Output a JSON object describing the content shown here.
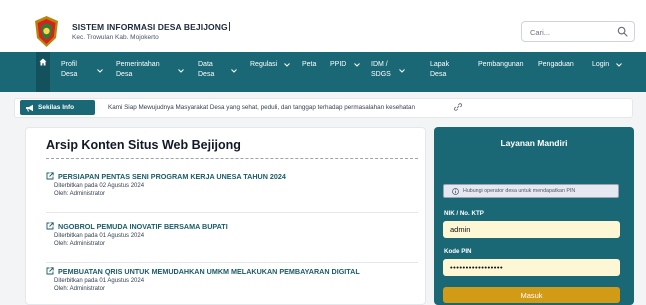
{
  "header": {
    "site_title": "SISTEM INFORMASI DESA BEJIJONG",
    "site_subtitle": "Kec. Trowulan Kab. Mojokerto",
    "search_placeholder": "Cari..."
  },
  "nav": {
    "items": [
      {
        "line1": "Profil",
        "line2": "Desa",
        "dropdown": true
      },
      {
        "line1": "Pemerintahan",
        "line2": "Desa",
        "dropdown": true
      },
      {
        "line1": "Data",
        "line2": "Desa",
        "dropdown": true
      },
      {
        "line1": "Regulasi",
        "line2": "",
        "dropdown": true
      },
      {
        "line1": "Peta",
        "line2": "",
        "dropdown": false
      },
      {
        "line1": "PPID",
        "line2": "",
        "dropdown": true
      },
      {
        "line1": "IDM /",
        "line2": "SDGS",
        "dropdown": true
      },
      {
        "line1": "Lapak",
        "line2": "Desa",
        "dropdown": false
      },
      {
        "line1": "Pembangunan",
        "line2": "",
        "dropdown": false
      },
      {
        "line1": "Pengaduan",
        "line2": "",
        "dropdown": false
      },
      {
        "line1": "Login",
        "line2": "",
        "dropdown": true
      }
    ]
  },
  "ticker": {
    "badge": "Sekilas Info",
    "text": "Kami Siap Mewujudnya Masyarakat Desa yang sehat, peduli, dan tanggap terhadap permasalahan kesehatan"
  },
  "archive": {
    "title": "Arsip Konten Situs Web Bejijong",
    "articles": [
      {
        "title": "PERSIAPAN PENTAS SENI PROGRAM KERJA UNESA TAHUN 2024",
        "date": "Diterbitkan pada 02 Agustus 2024",
        "author": "Oleh: Administrator"
      },
      {
        "title": "NGOBROL PEMUDA INOVATIF BERSAMA BUPATI",
        "date": "Diterbitkan pada 01 Agustus 2024",
        "author": "Oleh: Administrator"
      },
      {
        "title": "PEMBUATAN QRIS UNTUK MEMUDAHKAN UMKM MELAKUKAN PEMBAYARAN DIGITAL",
        "date": "Diterbitkan pada 01 Agustus 2024",
        "author": "Oleh: Administrator"
      }
    ]
  },
  "layanan": {
    "title": "Layanan Mandiri",
    "note": "Hubungi operator desa untuk mendapatkan PIN",
    "nik_label": "NIK / No. KTP",
    "nik_value": "admin",
    "pin_label": "Kode PIN",
    "pin_value": "•••••••••••••••••",
    "button": "Masuk"
  },
  "colors": {
    "nav": "#1a6876",
    "nav_active": "#13525d",
    "accent_button": "#d29b16",
    "input_fill": "#fdf7d5",
    "article_title": "#1a5b68"
  },
  "icons": [
    "village-emblem-logo",
    "search-icon",
    "home-icon",
    "chevron-down-icon",
    "bullhorn-icon",
    "link-icon",
    "external-link-icon",
    "info-icon"
  ]
}
